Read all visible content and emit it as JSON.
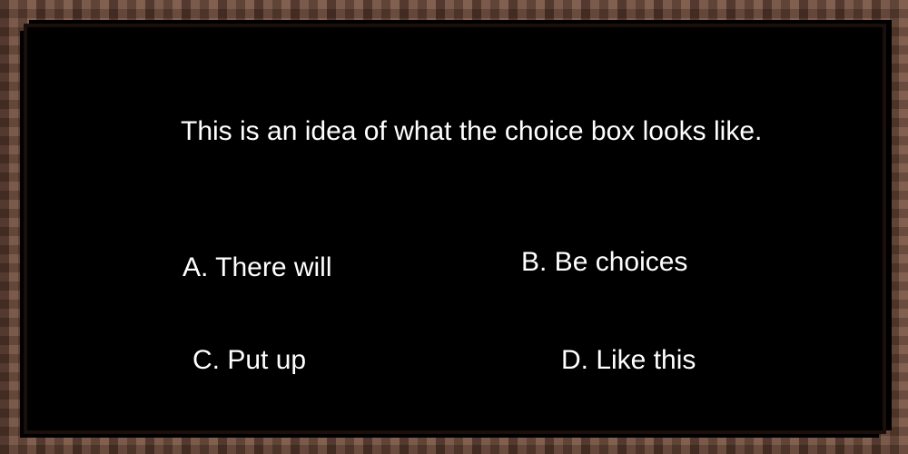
{
  "dialog": {
    "prompt": "This is an idea of what the choice box looks like."
  },
  "choices": [
    {
      "label": "A. There will"
    },
    {
      "label": "B. Be choices"
    },
    {
      "label": "C. Put up"
    },
    {
      "label": "D. Like this"
    }
  ],
  "colors": {
    "frame": "#6e4a3a",
    "background": "#000000",
    "text": "#ffffff"
  }
}
